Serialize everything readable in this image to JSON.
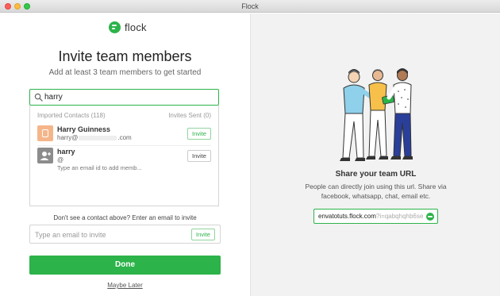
{
  "window": {
    "title": "Flock"
  },
  "brand": {
    "name": "flock",
    "color": "#2cb34a"
  },
  "invite": {
    "heading": "Invite team members",
    "subheading": "Add at least 3 team members to get started",
    "search_value": "harry",
    "imported_label": "Imported Contacts (118)",
    "sent_label": "Invites Sent (0)",
    "contacts": [
      {
        "name": "Harry Guinness",
        "email_prefix": "harry@",
        "email_suffix": ".com",
        "button": "Invite"
      },
      {
        "name": "harry",
        "email_prefix": "@",
        "hint": "Type an email id to add memb...",
        "button": "Invite"
      }
    ],
    "email_prompt": "Don't see a contact above? Enter an email to invite",
    "email_placeholder": "Type an email to invite",
    "email_button": "Invite",
    "done": "Done",
    "later": "Maybe Later"
  },
  "share": {
    "title": "Share your team URL",
    "description": "People can directly join using this url. Share via facebook, whatsapp, chat, email etc.",
    "url_domain": "envatotuts.flock.com",
    "url_code": "?i=qabqhqhb6se"
  },
  "icons": {
    "search": "search-icon",
    "logo": "flock-logo-icon",
    "copy": "copy-link-icon",
    "avatar_contact": "contact-avatar-icon",
    "avatar_unknown": "add-person-icon"
  }
}
